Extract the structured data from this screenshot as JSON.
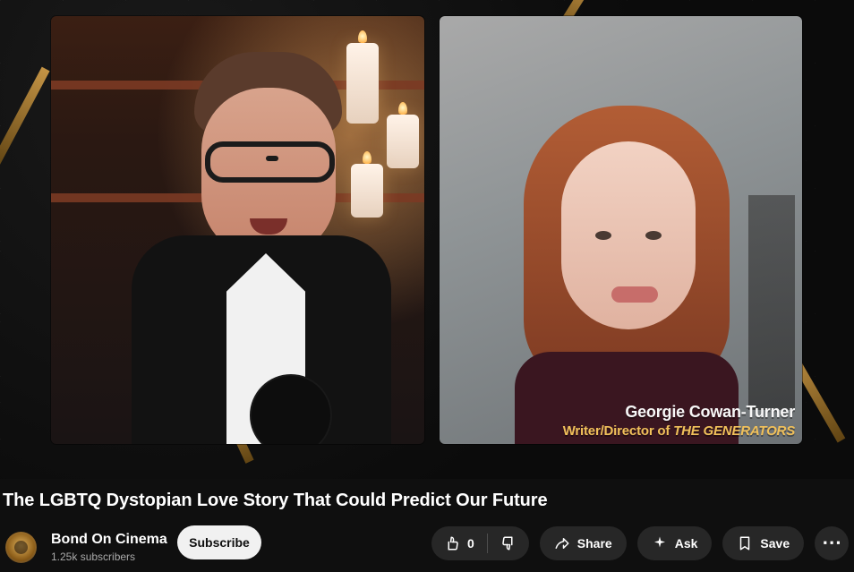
{
  "video": {
    "caption": {
      "name": "Georgie Cowan-Turner",
      "role_prefix": "Writer/Director of ",
      "role_title": "THE GENERATORS"
    }
  },
  "title": "The LGBTQ Dystopian Love Story That Could Predict Our Future",
  "channel": {
    "name": "Bond On Cinema",
    "subscribers": "1.25k subscribers"
  },
  "buttons": {
    "subscribe": "Subscribe",
    "like_count": "0",
    "share": "Share",
    "ask": "Ask",
    "save": "Save",
    "more": "⋯"
  },
  "icons": {
    "like": "thumbs-up-icon",
    "dislike": "thumbs-down-icon",
    "share": "share-arrow-icon",
    "ask": "sparkle-icon",
    "save": "bookmark-icon",
    "more": "more-horizontal-icon"
  },
  "colors": {
    "background": "#0f0f0f",
    "panel": "#272727",
    "muted": "#aaaaaa",
    "accent_gold": "#d8a24a"
  }
}
